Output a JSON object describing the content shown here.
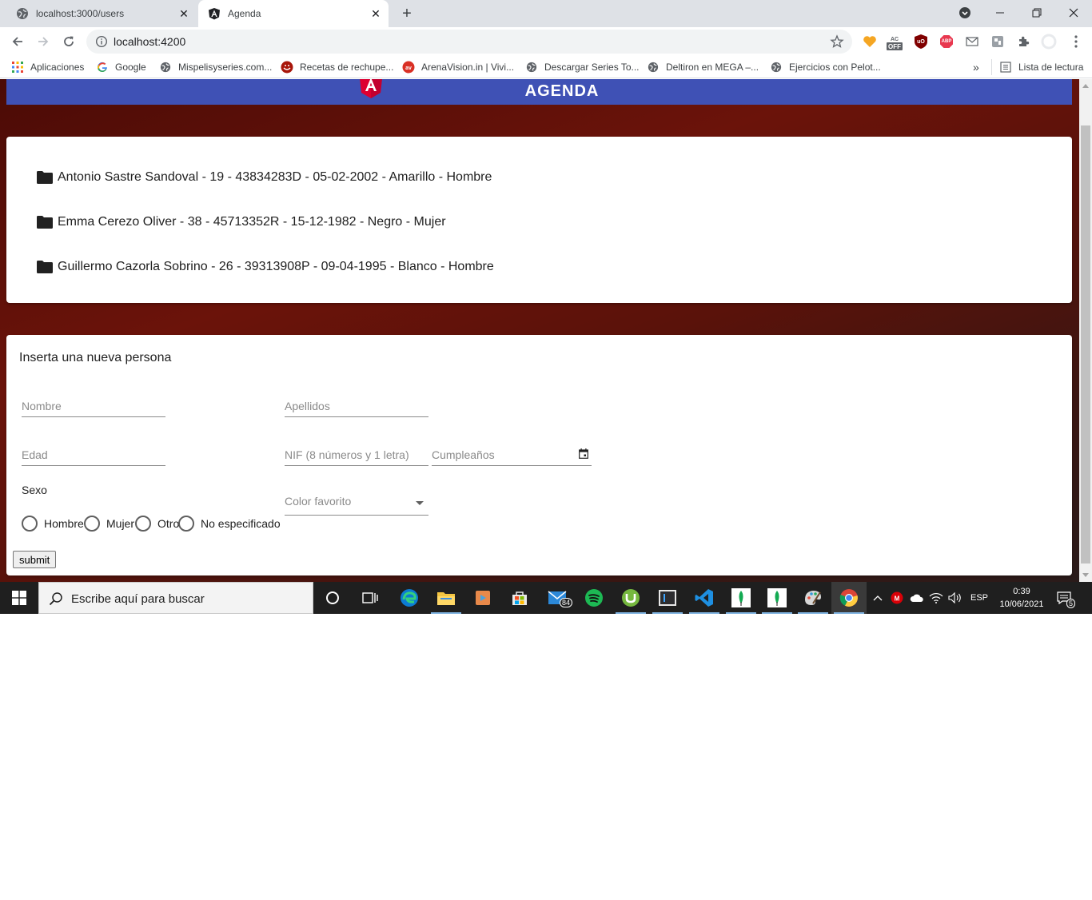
{
  "browser": {
    "tabs": [
      {
        "title": "localhost:3000/users",
        "active": false
      },
      {
        "title": "Agenda",
        "active": true
      }
    ],
    "url": "localhost:4200",
    "bookmarks": [
      "Aplicaciones",
      "Google",
      "Mispelisyseries.com...",
      "Recetas de rechupe...",
      "ArenaVision.in | Vivi...",
      "Descargar Series To...",
      "Deltiron en MEGA –...",
      "Ejercicios con Pelot..."
    ],
    "more_bookmarks": "»",
    "reading_list": "Lista de lectura",
    "ext_off_label": "OFF",
    "ext_abp_label": "ABP",
    "ext_ublock_label": "uO"
  },
  "app": {
    "title": "AGENDA"
  },
  "persons": [
    "Antonio Sastre Sandoval - 19 - 43834283D - 05-02-2002 - Amarillo - Hombre",
    "Emma Cerezo Oliver - 38 - 45713352R - 15-12-1982 - Negro - Mujer",
    "Guillermo Cazorla Sobrino - 26 - 39313908P - 09-04-1995 - Blanco - Hombre"
  ],
  "form": {
    "title": "Inserta una nueva persona",
    "nombre_placeholder": "Nombre",
    "apellidos_placeholder": "Apellidos",
    "edad_placeholder": "Edad",
    "nif_placeholder": "NIF (8 números y 1 letra)",
    "cumple_placeholder": "Cumpleaños",
    "sexo_label": "Sexo",
    "sexo_options": [
      "Hombre",
      "Mujer",
      "Otro",
      "No especificado"
    ],
    "color_label": "Color favorito",
    "submit_label": "submit"
  },
  "taskbar": {
    "search_placeholder": "Escribe aquí para buscar",
    "mail_badge": "84",
    "language": "ESP",
    "time": "0:39",
    "date": "10/06/2021",
    "notifications": "5"
  },
  "colors": {
    "header_blue": "#3f51b5",
    "background_dark_red": "#5a120a",
    "angular_red": "#dd0031"
  }
}
